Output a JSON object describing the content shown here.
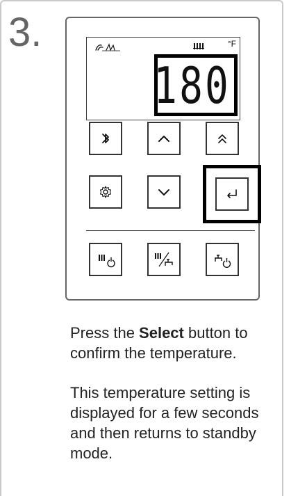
{
  "step": {
    "number": "3."
  },
  "display": {
    "temperature": "180",
    "unit": "°F",
    "icons": {
      "top_left": "flame-icon",
      "top_center": "radiator-icon"
    }
  },
  "buttons": {
    "row1": [
      "bluetooth-icon",
      "chevron-up-icon",
      "double-chevron-up-icon"
    ],
    "row2": [
      "gear-icon",
      "chevron-down-icon",
      "enter-icon"
    ],
    "row3": [
      "radiator-power-icon",
      "radiator-faucet-icon",
      "faucet-power-icon"
    ]
  },
  "instructions": {
    "paragraph1": {
      "before": "Press the ",
      "bold": "Select",
      "after": " button to confirm the temperature."
    },
    "paragraph2": "This temperature setting is displayed for a few seconds and then returns to standby mode."
  },
  "colors": {
    "frame_border": "#c9c9c9",
    "device_border": "#666666",
    "highlight": "#000000",
    "text": "#222222"
  }
}
